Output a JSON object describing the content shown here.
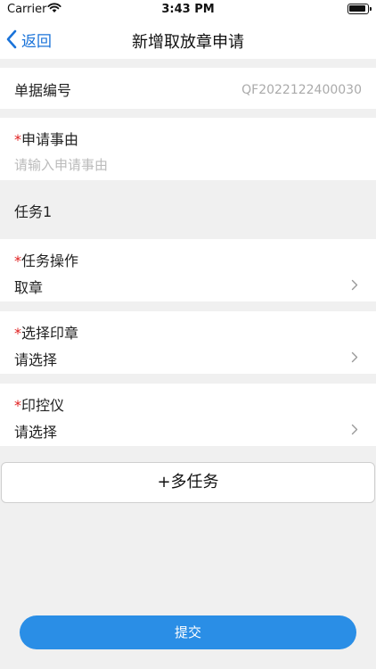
{
  "status_bar": {
    "carrier": "Carrier",
    "time": "3:43 PM"
  },
  "nav": {
    "back_label": "返回",
    "title": "新增取放章申请"
  },
  "form": {
    "doc_number": {
      "label": "单据编号",
      "value": "QF2022122400030"
    },
    "reason": {
      "required_mark": "*",
      "label": "申请事由",
      "placeholder": "请输入申请事由"
    }
  },
  "task": {
    "title": "任务1",
    "operation": {
      "required_mark": "*",
      "label": "任务操作",
      "value": "取章"
    },
    "seal": {
      "required_mark": "*",
      "label": "选择印章",
      "value": "请选择"
    },
    "device": {
      "required_mark": "*",
      "label": "印控仪",
      "value": "请选择"
    }
  },
  "buttons": {
    "add_task": "+多任务",
    "submit": "提交"
  },
  "colors": {
    "accent": "#2a8ee6",
    "link": "#1a73d9",
    "required": "#e02020",
    "background": "#f0f0f0"
  },
  "icons": [
    "wifi-icon",
    "battery-icon",
    "back-chevron-icon",
    "chevron-right-icon"
  ]
}
